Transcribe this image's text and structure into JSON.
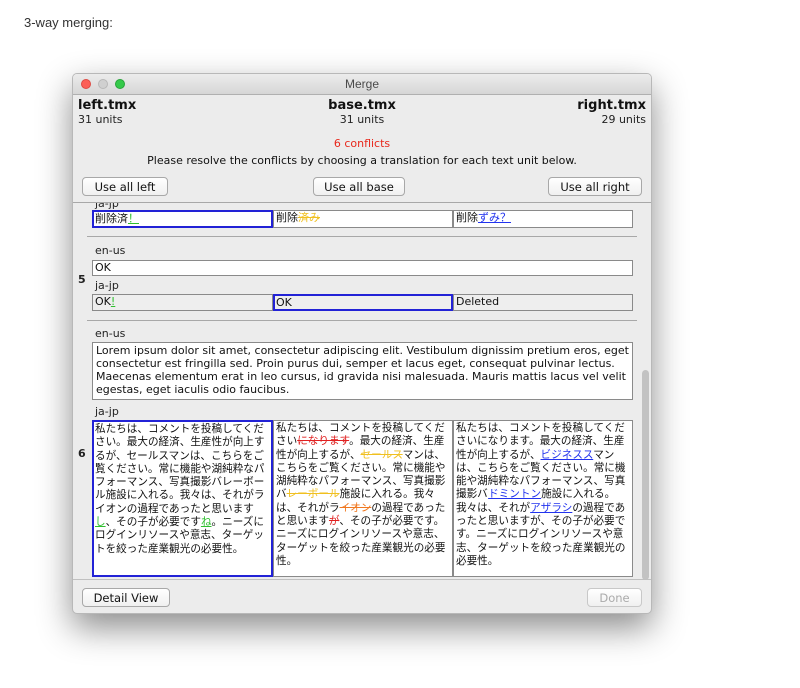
{
  "page_heading": "3-way merging:",
  "window": {
    "title": "Merge"
  },
  "files": {
    "left": {
      "name": "left.tmx",
      "units": "31 units"
    },
    "base": {
      "name": "base.tmx",
      "units": "31 units"
    },
    "right": {
      "name": "right.tmx",
      "units": "29 units"
    }
  },
  "conflicts_label": "6 conflicts",
  "instructions": "Please resolve the conflicts by choosing a translation for each text unit below.",
  "buttons": {
    "use_all_left": "Use all left",
    "use_all_base": "Use all base",
    "use_all_right": "Use all right",
    "detail_view": "Detail View",
    "done": "Done"
  },
  "locales": {
    "source": "en-us",
    "target": "ja-jp"
  },
  "unit4": {
    "left": {
      "text": "削除済",
      "ins": "！"
    },
    "base": {
      "text": "削除",
      "del": "済み"
    },
    "right": {
      "text": "削除",
      "ins": "ずみ？"
    }
  },
  "unit5": {
    "number": "5",
    "source": "OK",
    "left": {
      "text": "OK",
      "ins": "!"
    },
    "base": "OK",
    "right": "Deleted"
  },
  "unit6": {
    "number": "6",
    "source": "Lorem ipsum dolor sit amet, consectetur adipiscing elit. Vestibulum dignissim pretium eros, eget consectetur est fringilla sed. Proin purus dui, semper et lacus eget, consequat pulvinar lectus. Maecenas elementum erat in leo cursus, id gravida nisi malesuada. Mauris mattis lacus vel velit egestas, eget iaculis odio faucibus.",
    "left": {
      "p1": "私たちは、コメントを投稿してください。最大の経済、生産性が向上するが、セールスマンは、こちらをご覧ください。常に機能や湖純粋なパフォーマンス、写真撮影バレーボール施設に入れる。我々は、それがライオンの過程であったと思います",
      "ins1": "し",
      "p2": "、その子が必要です",
      "ins2": "ね",
      "p3": "。ニーズにログインリソースや意志、ターゲットを絞った産業観光の必要性。"
    },
    "base": {
      "p1": "私たちは、コメントを投稿してください",
      "del1": "になります",
      "p2": "。最大の経済、生産性が向上するが、",
      "del2": "セールス",
      "p3": "マンは、こちらをご覧ください。常に機能や湖純粋なパフォーマンス、写真撮影バ",
      "del3": "レーボール",
      "p4": "施設に入れる。我々は、それがラ",
      "del4": "イオン",
      "p5": "の過程であったと思います",
      "del5": "が",
      "p6": "、その子が必要です。ニーズにログインリソースや意志、ターゲットを絞った産業観光の必要性。"
    },
    "right": {
      "p1": "私たちは、コメントを投稿してくださいになります。最大の経済、生産性が向上するが、",
      "ins1": "ビジネスス",
      "p2": "マンは、こちらをご覧ください。常に機能や湖純粋なパフォーマンス、写真撮影バ",
      "ins2": "ドミントン",
      "p3": "施設に入れる。我々は、それが",
      "ins3": "アザラシ",
      "p4": "の過程であったと思いますが、その子が必要です。ニーズにログインリソースや意志、ターゲットを絞った産業観光の必要性。"
    }
  },
  "colors": {
    "selection": "#2222d6",
    "conflicts": "#e8281c",
    "insert_left": "#2fbf2f",
    "insert_right": "#2233ee",
    "delete_red": "#e02020",
    "delete_yellow": "#f0c020",
    "delete_orange": "#f07820"
  },
  "icons": [
    "close-light",
    "minimize-light-disabled",
    "zoom-light"
  ]
}
